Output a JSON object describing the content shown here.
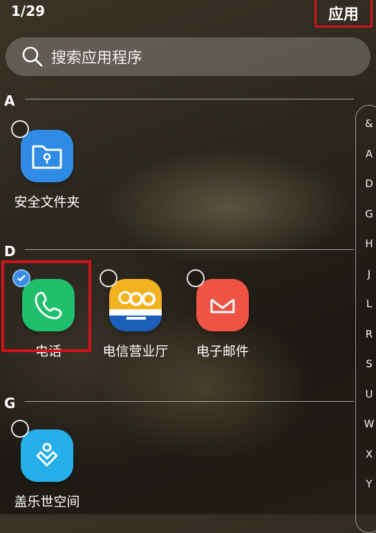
{
  "header": {
    "counter": "1/29",
    "title": "应用"
  },
  "search": {
    "placeholder": "搜索应用程序",
    "icon": "search-icon"
  },
  "sections": [
    {
      "letter": "A",
      "apps": [
        {
          "label": "安全文件夹",
          "icon": "folder-lock-icon",
          "color": "#2f8be3",
          "selected": false
        }
      ]
    },
    {
      "letter": "D",
      "apps": [
        {
          "label": "电话",
          "icon": "phone-icon",
          "color": "#1fbf6b",
          "selected": true
        },
        {
          "label": "电信营业厅",
          "icon": "telecom-go-icon",
          "color": "#f0a51c",
          "selected": false
        },
        {
          "label": "电子邮件",
          "icon": "mail-icon",
          "color": "#ef5344",
          "selected": false
        }
      ]
    },
    {
      "letter": "G",
      "apps": [
        {
          "label": "盖乐世空间",
          "icon": "heart-person-icon",
          "color": "#25aee8",
          "selected": false
        }
      ]
    }
  ],
  "index": [
    "&",
    "A",
    "D",
    "G",
    "H",
    "J",
    "L",
    "R",
    "S",
    "U",
    "W",
    "X",
    "Y"
  ]
}
